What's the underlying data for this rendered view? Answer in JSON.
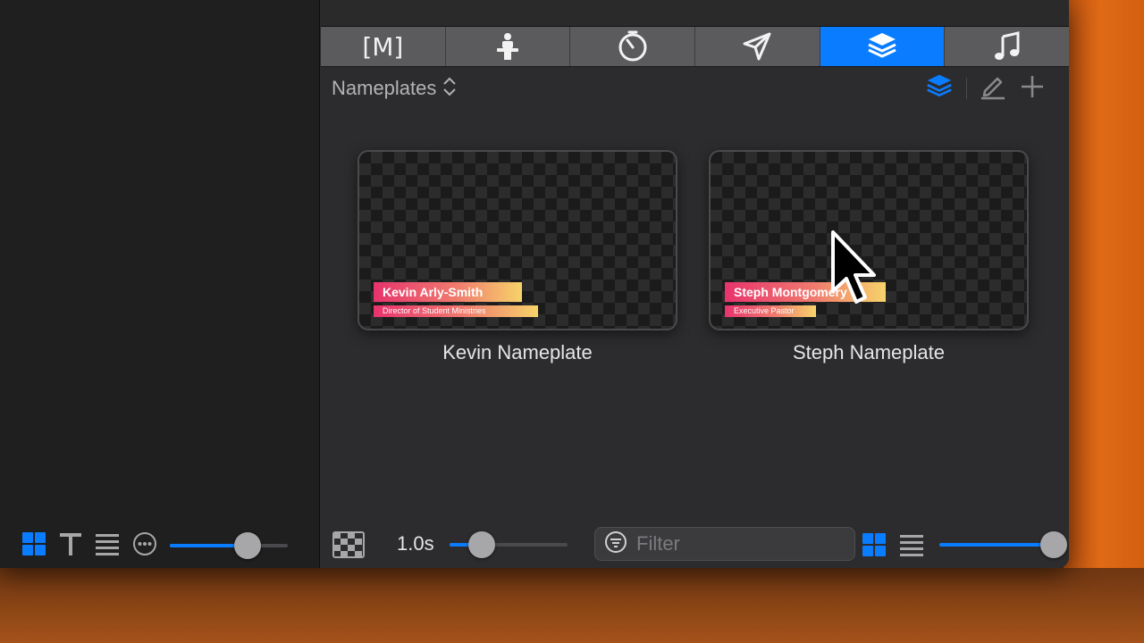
{
  "tabs": [
    {
      "icon": "media-bracket-icon",
      "label": "[M]"
    },
    {
      "icon": "stage-person-icon"
    },
    {
      "icon": "timer-icon"
    },
    {
      "icon": "send-arrow-icon"
    },
    {
      "icon": "layers-icon",
      "active": true
    },
    {
      "icon": "music-note-icon"
    }
  ],
  "library": {
    "title": "Nameplates",
    "actions": [
      "layers-icon",
      "edit-icon",
      "add-icon"
    ]
  },
  "cards": [
    {
      "label": "Kevin Nameplate",
      "preview_name": "Kevin Arly-Smith",
      "preview_role": "Director of Student Ministries"
    },
    {
      "label": "Steph Nameplate",
      "preview_name": "Steph Montgomery",
      "preview_role": "Executive Pastor"
    }
  ],
  "left_toolbar": {
    "icons": [
      "grid-view-icon",
      "text-view-icon",
      "list-view-icon",
      "more-icon"
    ],
    "zoom_fraction": 0.66
  },
  "bottom_bar": {
    "transition_icon": "checkerboard-icon",
    "duration": "1.0s",
    "duration_fraction": 0.27,
    "filter_placeholder": "Filter",
    "view_icons": [
      "grid-view-icon",
      "list-view-icon"
    ],
    "size_fraction": 0.97
  },
  "colors": {
    "accent": "#0a7cff",
    "nameplate_start": "#e8336d",
    "nameplate_end": "#f6d36a"
  }
}
